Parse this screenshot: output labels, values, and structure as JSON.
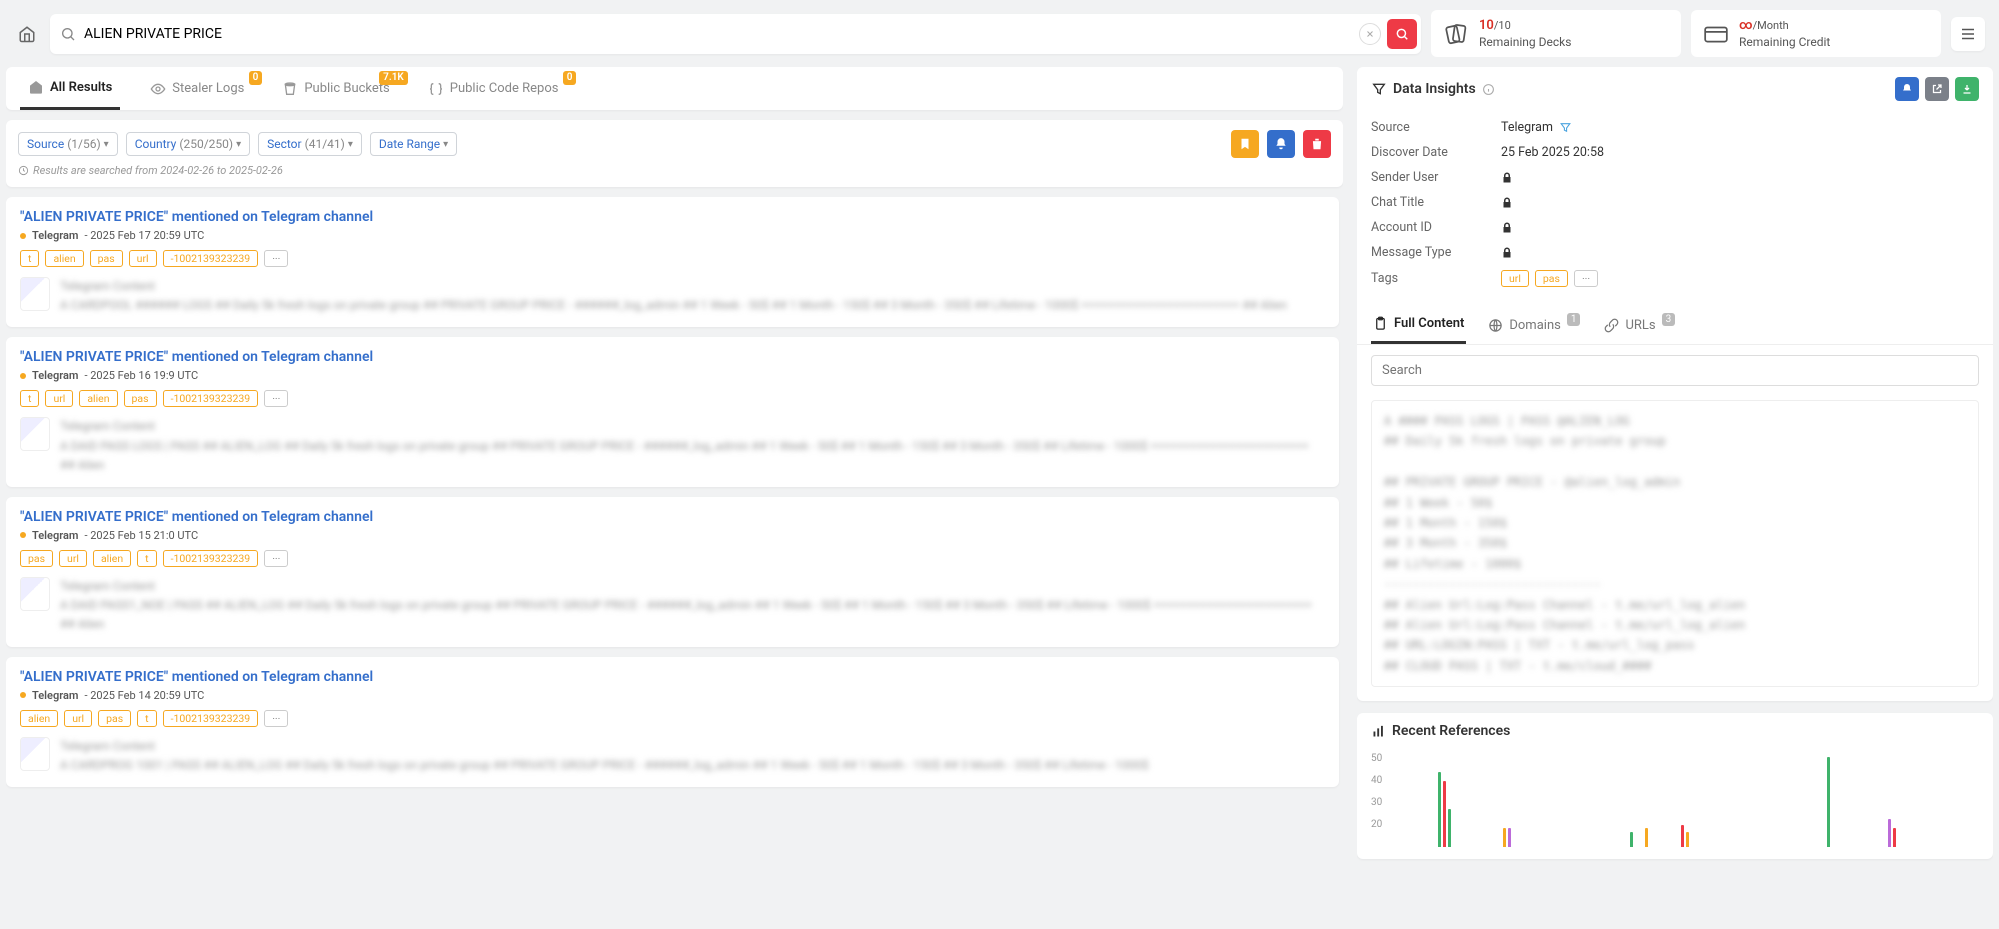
{
  "search": {
    "value": "ALIEN PRIVATE PRICE",
    "placeholder": "Search"
  },
  "topcards": {
    "decks": {
      "num": "10",
      "den": "/10",
      "label": "Remaining Decks"
    },
    "credit": {
      "sym": "∞",
      "per": "/Month",
      "label": "Remaining Credit"
    }
  },
  "tabs": [
    {
      "label": "All Results",
      "icon": "home",
      "active": true
    },
    {
      "label": "Stealer Logs",
      "icon": "eye",
      "badge": "0"
    },
    {
      "label": "Public Buckets",
      "icon": "bucket",
      "badge": "7.1K"
    },
    {
      "label": "Public Code Repos",
      "icon": "braces",
      "badge": "0"
    }
  ],
  "filters": {
    "source": {
      "label": "Source",
      "count": "(1/56)"
    },
    "country": {
      "label": "Country",
      "count": "(250/250)"
    },
    "sector": {
      "label": "Sector",
      "count": "(41/41)"
    },
    "daterange": {
      "label": "Date Range"
    },
    "hint": "Results are searched from 2024-02-26 to 2025-02-26"
  },
  "results": [
    {
      "title": "\"ALIEN PRIVATE PRICE\" mentioned on Telegram channel",
      "source": "Telegram",
      "date": "2025 Feb 17 20:59 UTC",
      "tags": [
        "t",
        "alien",
        "pas",
        "url",
        "-1002139323239"
      ],
      "blur": "A CARDPOOL ###### LOGS ## Daily 5k fresh logs on private group ## PRIVATE GROUP PRICE - ######_log_admin ## 1 Week - 50$ ## 1 Month - 150$ ## 3 Month - 350$ ## Lifetime - 1000$ ======================== ## Alien"
    },
    {
      "title": "\"ALIEN PRIVATE PRICE\" mentioned on Telegram channel",
      "source": "Telegram",
      "date": "2025 Feb 16 19:9 UTC",
      "tags": [
        "t",
        "url",
        "alien",
        "pas",
        "-1002139323239"
      ],
      "blur": "A DAID PASS LOGS | PASS ## ALIEN_LOG ## Daily 5k fresh logs on private group ## PRIVATE GROUP PRICE - ######_log_admin ## 1 Week - 50$ ## 1 Month - 150$ ## 3 Month - 350$ ## Lifetime - 1000$ ======================== ## Alien"
    },
    {
      "title": "\"ALIEN PRIVATE PRICE\" mentioned on Telegram channel",
      "source": "Telegram",
      "date": "2025 Feb 15 21:0 UTC",
      "tags": [
        "pas",
        "url",
        "alien",
        "t",
        "-1002139323239"
      ],
      "blur": "A DAID PASS1_NOE | PASS ## ALIEN_LOG ## Daily 5k fresh logs on private group ## PRIVATE GROUP PRICE - ######_log_admin ## 1 Week - 50$ ## 1 Month - 150$ ## 3 Month - 350$ ## Lifetime - 1000$ ======================== ## Alien"
    },
    {
      "title": "\"ALIEN PRIVATE PRICE\" mentioned on Telegram channel",
      "source": "Telegram",
      "date": "2025 Feb 14 20:59 UTC",
      "tags": [
        "alien",
        "url",
        "pas",
        "t",
        "-1002139323239"
      ],
      "blur": "A CARDPROG 1001 | PASS ## ALIEN_LOG ## Daily 5k fresh logs on private group ## PRIVATE GROUP PRICE - ######_log_admin ## 1 Week - 50$ ## 1 Month - 150$ ## 3 Month - 350$ ## Lifetime - 1000$"
    }
  ],
  "insights": {
    "title": "Data Insights",
    "kv": {
      "source_k": "Source",
      "source_v": "Telegram",
      "discover_k": "Discover Date",
      "discover_v": "25 Feb 2025 20:58",
      "sender_k": "Sender User",
      "chat_k": "Chat Title",
      "acct_k": "Account ID",
      "msgtype_k": "Message Type",
      "tags_k": "Tags"
    },
    "tag_chips": [
      "url",
      "pas"
    ],
    "itabs": {
      "full": "Full Content",
      "domains": "Domains",
      "domains_n": "1",
      "urls": "URLs",
      "urls_n": "3"
    },
    "search_ph": "Search",
    "content_blur": "A #### PASS LOGS | PASS @ALIEN_LOG\n## Daily 5k fresh logs on private group\n\n## PRIVATE GROUP PRICE - @alien_log_admin\n## 1 Week  - 50$\n## 1 Month - 150$\n## 3 Month - 350$\n## Lifetime - 1000$\n------------------------------\n## Alien Url:Log:Pass Channel - t.me/url_log_alien\n## Alien Url:Log:Pass Channel - t.me/url_log_alien\n## URL:LOGIN:PASS | TXT - t.me/url_log_pass\n## CLOUD PASS | TXT - t.me/cloud_####"
  },
  "references": {
    "title": "Recent References"
  },
  "chart_data": {
    "type": "bar",
    "ylim": [
      0,
      50
    ],
    "yticks": [
      50,
      40,
      30,
      20
    ],
    "series": [
      {
        "h": 0,
        "c": "#ccc"
      },
      {
        "h": 0,
        "c": "#ccc"
      },
      {
        "h": 0,
        "c": "#ccc"
      },
      {
        "h": 0,
        "c": "#ccc"
      },
      {
        "h": 0,
        "c": "#ccc"
      },
      {
        "h": 0,
        "c": "#ccc"
      },
      {
        "h": 0,
        "c": "#ccc"
      },
      {
        "h": 0,
        "c": "#ccc"
      },
      {
        "h": 40,
        "c": "#3fb36b"
      },
      {
        "h": 35,
        "c": "#ee3a46"
      },
      {
        "h": 20,
        "c": "#3fb36b"
      },
      {
        "h": 0,
        "c": "#ccc"
      },
      {
        "h": 0,
        "c": "#ccc"
      },
      {
        "h": 0,
        "c": "#ccc"
      },
      {
        "h": 0,
        "c": "#ccc"
      },
      {
        "h": 0,
        "c": "#ccc"
      },
      {
        "h": 0,
        "c": "#ccc"
      },
      {
        "h": 0,
        "c": "#ccc"
      },
      {
        "h": 0,
        "c": "#ccc"
      },
      {
        "h": 0,
        "c": "#ccc"
      },
      {
        "h": 0,
        "c": "#ccc"
      },
      {
        "h": 10,
        "c": "#f6a821"
      },
      {
        "h": 10,
        "c": "#bb6bd9"
      },
      {
        "h": 0,
        "c": "#ccc"
      },
      {
        "h": 0,
        "c": "#ccc"
      },
      {
        "h": 0,
        "c": "#ccc"
      },
      {
        "h": 0,
        "c": "#ccc"
      },
      {
        "h": 0,
        "c": "#ccc"
      },
      {
        "h": 0,
        "c": "#ccc"
      },
      {
        "h": 0,
        "c": "#ccc"
      },
      {
        "h": 0,
        "c": "#ccc"
      },
      {
        "h": 0,
        "c": "#ccc"
      },
      {
        "h": 0,
        "c": "#ccc"
      },
      {
        "h": 0,
        "c": "#ccc"
      },
      {
        "h": 0,
        "c": "#ccc"
      },
      {
        "h": 0,
        "c": "#ccc"
      },
      {
        "h": 0,
        "c": "#ccc"
      },
      {
        "h": 0,
        "c": "#ccc"
      },
      {
        "h": 0,
        "c": "#ccc"
      },
      {
        "h": 0,
        "c": "#ccc"
      },
      {
        "h": 0,
        "c": "#ccc"
      },
      {
        "h": 0,
        "c": "#ccc"
      },
      {
        "h": 0,
        "c": "#ccc"
      },
      {
        "h": 0,
        "c": "#ccc"
      },
      {
        "h": 0,
        "c": "#ccc"
      },
      {
        "h": 0,
        "c": "#ccc"
      },
      {
        "h": 8,
        "c": "#3fb36b"
      },
      {
        "h": 0,
        "c": "#ccc"
      },
      {
        "h": 0,
        "c": "#ccc"
      },
      {
        "h": 10,
        "c": "#f6a821"
      },
      {
        "h": 0,
        "c": "#ccc"
      },
      {
        "h": 0,
        "c": "#ccc"
      },
      {
        "h": 0,
        "c": "#ccc"
      },
      {
        "h": 0,
        "c": "#ccc"
      },
      {
        "h": 0,
        "c": "#ccc"
      },
      {
        "h": 0,
        "c": "#ccc"
      },
      {
        "h": 12,
        "c": "#ee3a46"
      },
      {
        "h": 8,
        "c": "#f6a821"
      },
      {
        "h": 0,
        "c": "#ccc"
      },
      {
        "h": 0,
        "c": "#ccc"
      },
      {
        "h": 0,
        "c": "#ccc"
      },
      {
        "h": 0,
        "c": "#ccc"
      },
      {
        "h": 0,
        "c": "#ccc"
      },
      {
        "h": 0,
        "c": "#ccc"
      },
      {
        "h": 0,
        "c": "#ccc"
      },
      {
        "h": 0,
        "c": "#ccc"
      },
      {
        "h": 0,
        "c": "#ccc"
      },
      {
        "h": 0,
        "c": "#ccc"
      },
      {
        "h": 0,
        "c": "#ccc"
      },
      {
        "h": 0,
        "c": "#ccc"
      },
      {
        "h": 0,
        "c": "#ccc"
      },
      {
        "h": 0,
        "c": "#ccc"
      },
      {
        "h": 0,
        "c": "#ccc"
      },
      {
        "h": 0,
        "c": "#ccc"
      },
      {
        "h": 0,
        "c": "#ccc"
      },
      {
        "h": 0,
        "c": "#ccc"
      },
      {
        "h": 0,
        "c": "#ccc"
      },
      {
        "h": 0,
        "c": "#ccc"
      },
      {
        "h": 0,
        "c": "#ccc"
      },
      {
        "h": 0,
        "c": "#ccc"
      },
      {
        "h": 0,
        "c": "#ccc"
      },
      {
        "h": 0,
        "c": "#ccc"
      },
      {
        "h": 0,
        "c": "#ccc"
      },
      {
        "h": 0,
        "c": "#ccc"
      },
      {
        "h": 0,
        "c": "#ccc"
      },
      {
        "h": 48,
        "c": "#3fb36b"
      },
      {
        "h": 0,
        "c": "#ccc"
      },
      {
        "h": 0,
        "c": "#ccc"
      },
      {
        "h": 0,
        "c": "#ccc"
      },
      {
        "h": 0,
        "c": "#ccc"
      },
      {
        "h": 0,
        "c": "#ccc"
      },
      {
        "h": 0,
        "c": "#ccc"
      },
      {
        "h": 0,
        "c": "#ccc"
      },
      {
        "h": 0,
        "c": "#ccc"
      },
      {
        "h": 0,
        "c": "#ccc"
      },
      {
        "h": 0,
        "c": "#ccc"
      },
      {
        "h": 0,
        "c": "#ccc"
      },
      {
        "h": 15,
        "c": "#bb6bd9"
      },
      {
        "h": 10,
        "c": "#ee3a46"
      },
      {
        "h": 0,
        "c": "#ccc"
      },
      {
        "h": 0,
        "c": "#ccc"
      },
      {
        "h": 0,
        "c": "#ccc"
      },
      {
        "h": 0,
        "c": "#ccc"
      },
      {
        "h": 0,
        "c": "#ccc"
      },
      {
        "h": 0,
        "c": "#ccc"
      },
      {
        "h": 0,
        "c": "#ccc"
      },
      {
        "h": 0,
        "c": "#ccc"
      },
      {
        "h": 0,
        "c": "#ccc"
      },
      {
        "h": 0,
        "c": "#ccc"
      },
      {
        "h": 0,
        "c": "#ccc"
      },
      {
        "h": 0,
        "c": "#ccc"
      },
      {
        "h": 0,
        "c": "#ccc"
      },
      {
        "h": 0,
        "c": "#ccc"
      },
      {
        "h": 0,
        "c": "#ccc"
      },
      {
        "h": 0,
        "c": "#ccc"
      },
      {
        "h": 0,
        "c": "#ccc"
      }
    ]
  }
}
